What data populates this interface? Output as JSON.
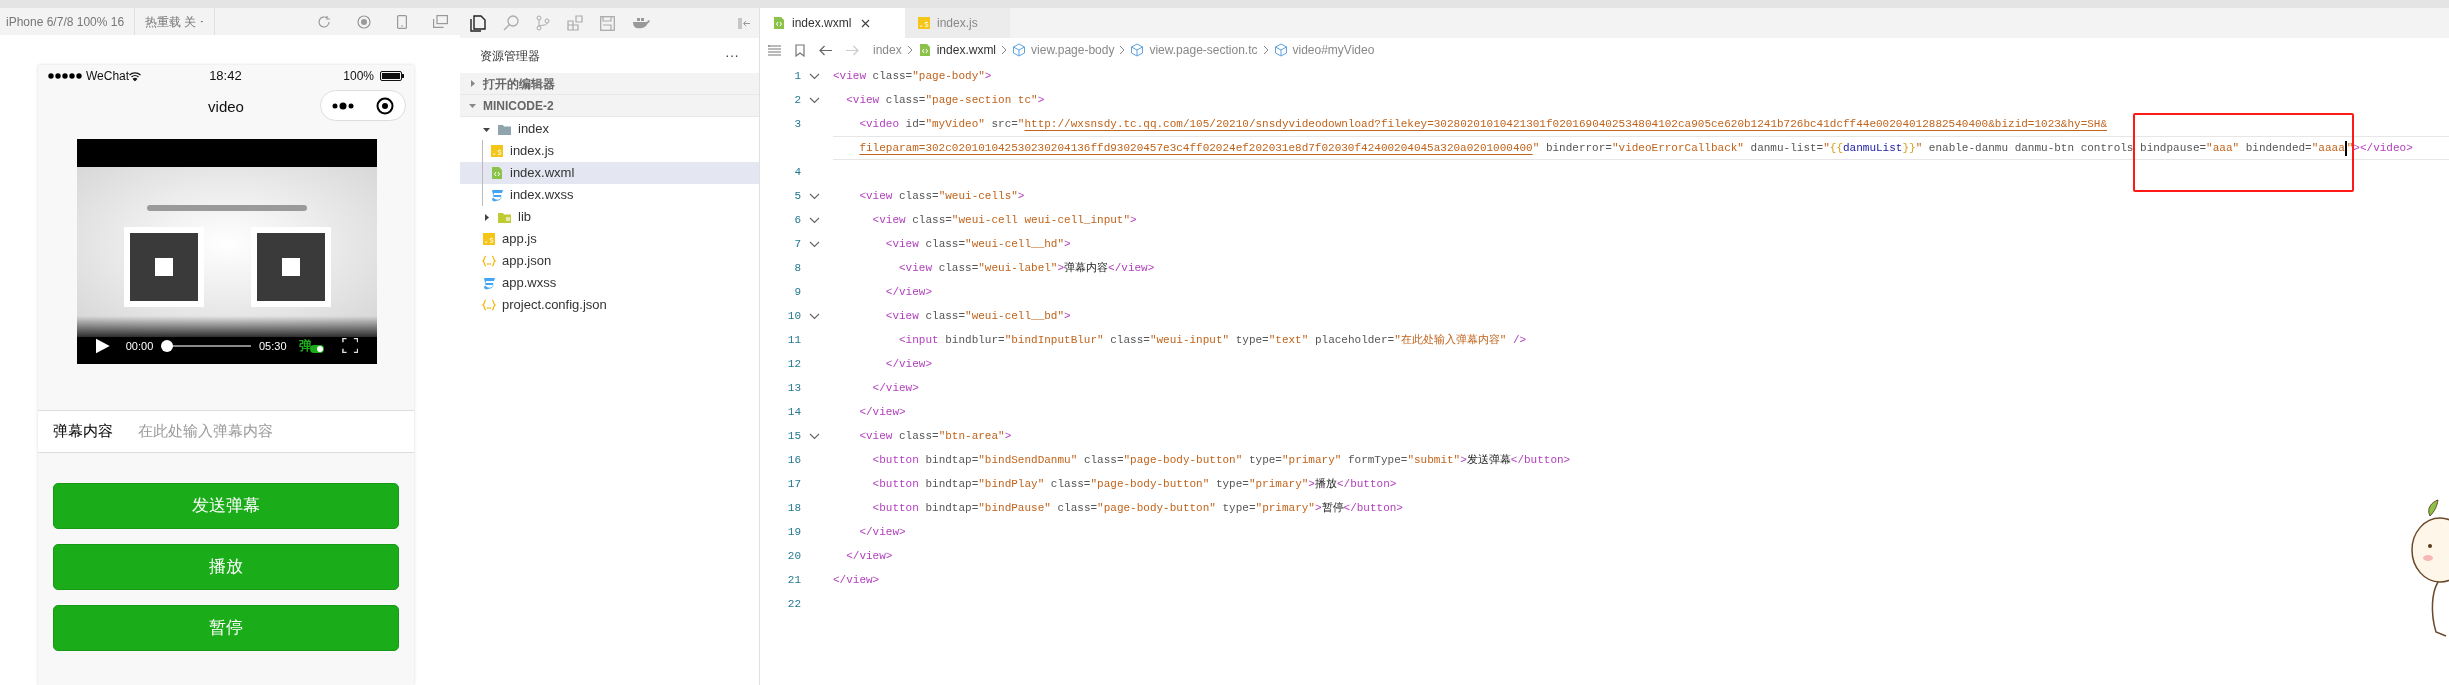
{
  "simulator_toolbar": {
    "device": "iPhone 6/7/8 100% 16",
    "hot_reload": "热重载 关"
  },
  "phone": {
    "carrier": "WeChat",
    "time": "18:42",
    "battery": "100%",
    "title": "video",
    "video": {
      "kind": "picture",
      "current_time": "00:00",
      "level": 0,
      "duration": "05:30",
      "danmu_label": "弹",
      "danmu_on": true
    },
    "form": {
      "label": "弹幕内容",
      "placeholder": "在此处输入弹幕内容"
    },
    "buttons": [
      "发送弹幕",
      "播放",
      "暂停"
    ]
  },
  "explorer": {
    "title": "资源管理器",
    "more": "···",
    "sections": [
      {
        "label": "打开的编辑器",
        "expanded": false
      },
      {
        "label": "MINICODE-2",
        "expanded": true,
        "children": [
          {
            "label": "index",
            "kind": "folder",
            "expanded": true,
            "selected": false,
            "children": [
              {
                "label": "index.js",
                "kind": "js",
                "selected": false
              },
              {
                "label": "index.wxml",
                "kind": "wxml",
                "selected": true
              },
              {
                "label": "index.wxss",
                "kind": "wxss",
                "selected": false
              }
            ]
          },
          {
            "label": "lib",
            "kind": "lib",
            "expanded": false,
            "selected": false
          },
          {
            "label": "app.js",
            "kind": "js",
            "selected": false
          },
          {
            "label": "app.json",
            "kind": "json",
            "selected": false
          },
          {
            "label": "app.wxss",
            "kind": "wxss",
            "selected": false
          },
          {
            "label": "project.config.json",
            "kind": "json",
            "selected": false
          }
        ]
      }
    ]
  },
  "editor": {
    "tabs": [
      {
        "label": "index.wxml",
        "kind": "wxml",
        "selected": true
      },
      {
        "label": "index.js",
        "kind": "js",
        "selected": false
      }
    ],
    "breadcrumbs": [
      {
        "label": "index",
        "kind": "folder"
      },
      {
        "label": "index.wxml",
        "kind": "wxml"
      },
      {
        "label": "view.page-body",
        "kind": "element"
      },
      {
        "label": "view.page-section.tc",
        "kind": "element"
      },
      {
        "label": "video#myVideo",
        "kind": "element"
      }
    ],
    "lines": [
      {
        "number": "1",
        "foldable": true,
        "current": false,
        "segments": [
          {
            "kind": "tag",
            "text": "<view"
          },
          {
            "kind": "attr",
            "text": " class="
          },
          {
            "kind": "str",
            "text": "\"page-body\""
          },
          {
            "kind": "tag",
            "text": ">"
          }
        ]
      },
      {
        "number": "2",
        "foldable": true,
        "current": false,
        "segments": [
          {
            "kind": "tag",
            "text": "  <view"
          },
          {
            "kind": "attr",
            "text": " class="
          },
          {
            "kind": "str",
            "text": "\"page-section tc\""
          },
          {
            "kind": "tag",
            "text": ">"
          }
        ]
      },
      {
        "number": "3",
        "foldable": false,
        "current": false,
        "segments": [
          {
            "kind": "tag",
            "text": "    <video"
          },
          {
            "kind": "attr",
            "text": " id="
          },
          {
            "kind": "str",
            "text": "\"myVideo\""
          },
          {
            "kind": "attr",
            "text": " src="
          },
          {
            "kind": "str",
            "text": "\""
          },
          {
            "kind": "link",
            "text": "http://wxsnsdy.tc.qq.com/105/20210/snsdyvideodownload?filekey=30280201010421301f0201690402534804102ca905ce620b1241b726bc41dcff44e00204012882540400&bizid=1023&hy=SH&"
          }
        ]
      },
      {
        "foldable": false,
        "current": true,
        "segments": [
          {
            "kind": "link",
            "text": "fileparam=302c020101042530230204136ffd93020457e3c4ff02024ef202031e8d7f02030f42400204045a320a0201000400"
          },
          {
            "kind": "str",
            "text": "\""
          },
          {
            "kind": "attr",
            "text": " binderror="
          },
          {
            "kind": "str",
            "text": "\"videoErrorCallback\""
          },
          {
            "kind": "attr",
            "text": " danmu-list="
          },
          {
            "kind": "str",
            "text": "\""
          },
          {
            "kind": "brace",
            "text": "{{"
          },
          {
            "kind": "var",
            "text": "danmuList"
          },
          {
            "kind": "brace",
            "text": "}}"
          },
          {
            "kind": "str",
            "text": "\""
          },
          {
            "kind": "attr",
            "text": " enable-danmu danmu-btn controls bindpause="
          },
          {
            "kind": "str",
            "text": "\"aaa\""
          },
          {
            "kind": "attr",
            "text": " bindended="
          },
          {
            "kind": "str",
            "text": "\"aaaa"
          },
          {
            "kind": "cursor"
          },
          {
            "kind": "str",
            "text": "\""
          },
          {
            "kind": "tag",
            "text": "></video>"
          }
        ]
      },
      {
        "number": "4",
        "foldable": false,
        "current": false
      },
      {
        "number": "5",
        "foldable": true,
        "current": false,
        "segments": [
          {
            "kind": "tag",
            "text": "    <view"
          },
          {
            "kind": "attr",
            "text": " class="
          },
          {
            "kind": "str",
            "text": "\"weui-cells\""
          },
          {
            "kind": "tag",
            "text": ">"
          }
        ]
      },
      {
        "number": "6",
        "foldable": true,
        "current": false,
        "segments": [
          {
            "kind": "tag",
            "text": "      <view"
          },
          {
            "kind": "attr",
            "text": " class="
          },
          {
            "kind": "str",
            "text": "\"weui-cell weui-cell_input\""
          },
          {
            "kind": "tag",
            "text": ">"
          }
        ]
      },
      {
        "number": "7",
        "foldable": true,
        "current": false,
        "segments": [
          {
            "kind": "tag",
            "text": "        <view"
          },
          {
            "kind": "attr",
            "text": " class="
          },
          {
            "kind": "str",
            "text": "\"weui-cell__hd\""
          },
          {
            "kind": "tag",
            "text": ">"
          }
        ]
      },
      {
        "number": "8",
        "foldable": false,
        "current": false,
        "segments": [
          {
            "kind": "tag",
            "text": "          <view"
          },
          {
            "kind": "attr",
            "text": " class="
          },
          {
            "kind": "str",
            "text": "\"weui-label\""
          },
          {
            "kind": "tag",
            "text": ">"
          },
          {
            "kind": "text",
            "text": "弹幕内容"
          },
          {
            "kind": "tag",
            "text": "</view>"
          }
        ]
      },
      {
        "number": "9",
        "foldable": false,
        "current": false,
        "segments": [
          {
            "kind": "tag",
            "text": "        </view>"
          }
        ]
      },
      {
        "number": "10",
        "foldable": true,
        "current": false,
        "segments": [
          {
            "kind": "tag",
            "text": "        <view"
          },
          {
            "kind": "attr",
            "text": " class="
          },
          {
            "kind": "str",
            "text": "\"weui-cell__bd\""
          },
          {
            "kind": "tag",
            "text": ">"
          }
        ]
      },
      {
        "number": "11",
        "foldable": false,
        "current": false,
        "segments": [
          {
            "kind": "tag",
            "text": "          <input"
          },
          {
            "kind": "attr",
            "text": " bindblur="
          },
          {
            "kind": "str",
            "text": "\"bindInputBlur\""
          },
          {
            "kind": "attr",
            "text": " class="
          },
          {
            "kind": "str",
            "text": "\"weui-input\""
          },
          {
            "kind": "attr",
            "text": " type="
          },
          {
            "kind": "str",
            "text": "\"text\""
          },
          {
            "kind": "attr",
            "text": " placeholder="
          },
          {
            "kind": "str",
            "text": "\"在此处输入弹幕内容\""
          },
          {
            "kind": "tag",
            "text": " />"
          }
        ]
      },
      {
        "number": "12",
        "foldable": false,
        "current": false,
        "segments": [
          {
            "kind": "tag",
            "text": "        </view>"
          }
        ]
      },
      {
        "number": "13",
        "foldable": false,
        "current": false,
        "segments": [
          {
            "kind": "tag",
            "text": "      </view>"
          }
        ]
      },
      {
        "number": "14",
        "foldable": false,
        "current": false,
        "segments": [
          {
            "kind": "tag",
            "text": "    </view>"
          }
        ]
      },
      {
        "number": "15",
        "foldable": true,
        "current": false,
        "segments": [
          {
            "kind": "tag",
            "text": "    <view"
          },
          {
            "kind": "attr",
            "text": " class="
          },
          {
            "kind": "str",
            "text": "\"btn-area\""
          },
          {
            "kind": "tag",
            "text": ">"
          }
        ]
      },
      {
        "number": "16",
        "foldable": false,
        "current": false,
        "segments": [
          {
            "kind": "tag",
            "text": "      <button"
          },
          {
            "kind": "attr",
            "text": " bindtap="
          },
          {
            "kind": "str",
            "text": "\"bindSendDanmu\""
          },
          {
            "kind": "attr",
            "text": " class="
          },
          {
            "kind": "str",
            "text": "\"page-body-button\""
          },
          {
            "kind": "attr",
            "text": " type="
          },
          {
            "kind": "str",
            "text": "\"primary\""
          },
          {
            "kind": "attr",
            "text": " formType="
          },
          {
            "kind": "str",
            "text": "\"submit\""
          },
          {
            "kind": "tag",
            "text": ">"
          },
          {
            "kind": "text",
            "text": "发送弹幕"
          },
          {
            "kind": "tag",
            "text": "</button>"
          }
        ]
      },
      {
        "number": "17",
        "foldable": false,
        "current": false,
        "segments": [
          {
            "kind": "tag",
            "text": "      <button"
          },
          {
            "kind": "attr",
            "text": " bindtap="
          },
          {
            "kind": "str",
            "text": "\"bindPlay\""
          },
          {
            "kind": "attr",
            "text": " class="
          },
          {
            "kind": "str",
            "text": "\"page-body-button\""
          },
          {
            "kind": "attr",
            "text": " type="
          },
          {
            "kind": "str",
            "text": "\"primary\""
          },
          {
            "kind": "tag",
            "text": ">"
          },
          {
            "kind": "text",
            "text": "播放"
          },
          {
            "kind": "tag",
            "text": "</button>"
          }
        ]
      },
      {
        "number": "18",
        "foldable": false,
        "current": false,
        "segments": [
          {
            "kind": "tag",
            "text": "      <button"
          },
          {
            "kind": "attr",
            "text": " bindtap="
          },
          {
            "kind": "str",
            "text": "\"bindPause\""
          },
          {
            "kind": "attr",
            "text": " class="
          },
          {
            "kind": "str",
            "text": "\"page-body-button\""
          },
          {
            "kind": "attr",
            "text": " type="
          },
          {
            "kind": "str",
            "text": "\"primary\""
          },
          {
            "kind": "tag",
            "text": ">"
          },
          {
            "kind": "text",
            "text": "暂停"
          },
          {
            "kind": "tag",
            "text": "</button>"
          }
        ]
      },
      {
        "number": "19",
        "foldable": false,
        "current": false,
        "segments": [
          {
            "kind": "tag",
            "text": "    </view>"
          }
        ]
      },
      {
        "number": "20",
        "foldable": false,
        "current": false,
        "segments": [
          {
            "kind": "tag",
            "text": "  </view>"
          }
        ]
      },
      {
        "number": "21",
        "foldable": false,
        "current": false,
        "segments": [
          {
            "kind": "tag",
            "text": "</view>"
          }
        ]
      },
      {
        "number": "22",
        "foldable": false,
        "current": false
      }
    ]
  }
}
